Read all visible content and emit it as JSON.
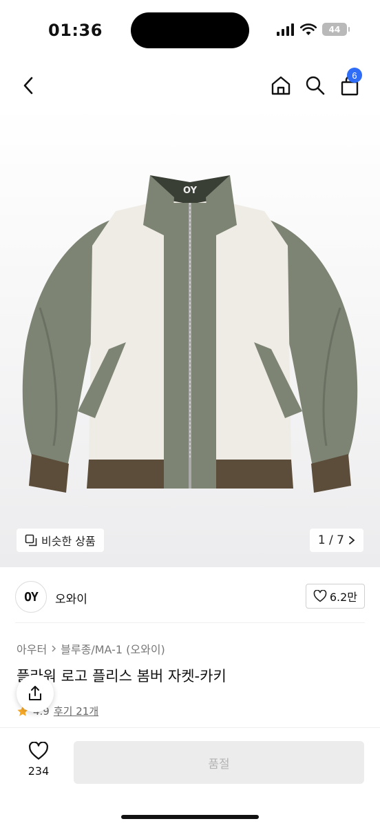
{
  "status_bar": {
    "time": "01:36",
    "battery": "44"
  },
  "nav": {
    "cart_count": "6"
  },
  "hero": {
    "similar_label": "비슷한 상품",
    "pager": "1 / 7",
    "logo_text": "OY"
  },
  "brand": {
    "logo_text": "OY",
    "name": "오와이",
    "likes": "6.2만"
  },
  "breadcrumb": {
    "level1": "아우터",
    "level2": "블루종/MA-1 (오와이)"
  },
  "product": {
    "title": "플라워 로고 플리스 봄버 자켓-카키",
    "rating": "4.9",
    "reviews": "후기 21개"
  },
  "bottom": {
    "wish_count": "234",
    "soldout_label": "품절"
  },
  "colors": {
    "accent_badge": "#2f6df6",
    "jacket_khaki": "#7d8474",
    "fleece": "#efece6",
    "rib": "#5c4d3a"
  }
}
